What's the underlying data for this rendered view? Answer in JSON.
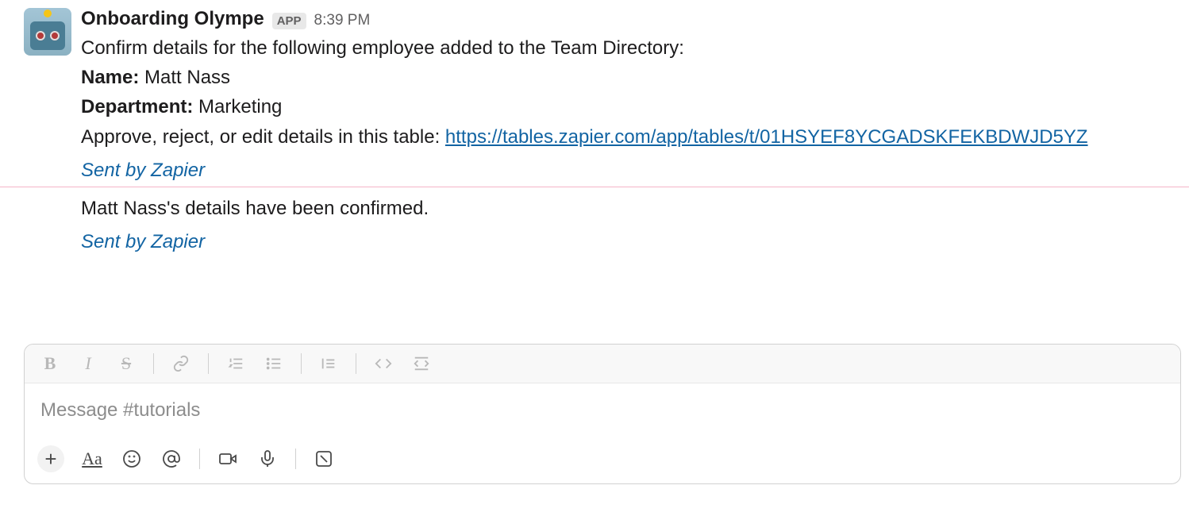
{
  "message": {
    "sender": "Onboarding Olympe",
    "app_badge": "APP",
    "timestamp": "8:39 PM",
    "intro": "Confirm details for the following employee added to the Team Directory:",
    "name_label": "Name:",
    "name_value": "Matt Nass",
    "dept_label": "Department:",
    "dept_value": "Marketing",
    "action_prefix": "Approve, reject, or edit details in this table: ",
    "link_text": "https://tables.zapier.com/app/tables/t/01HSYEF8YCGADSKFEKBDWJD5YZ",
    "sent_by": "Sent by Zapier"
  },
  "followup": {
    "text": "Matt Nass's details have been confirmed.",
    "sent_by": "Sent by Zapier"
  },
  "composer": {
    "placeholder": "Message #tutorials"
  }
}
